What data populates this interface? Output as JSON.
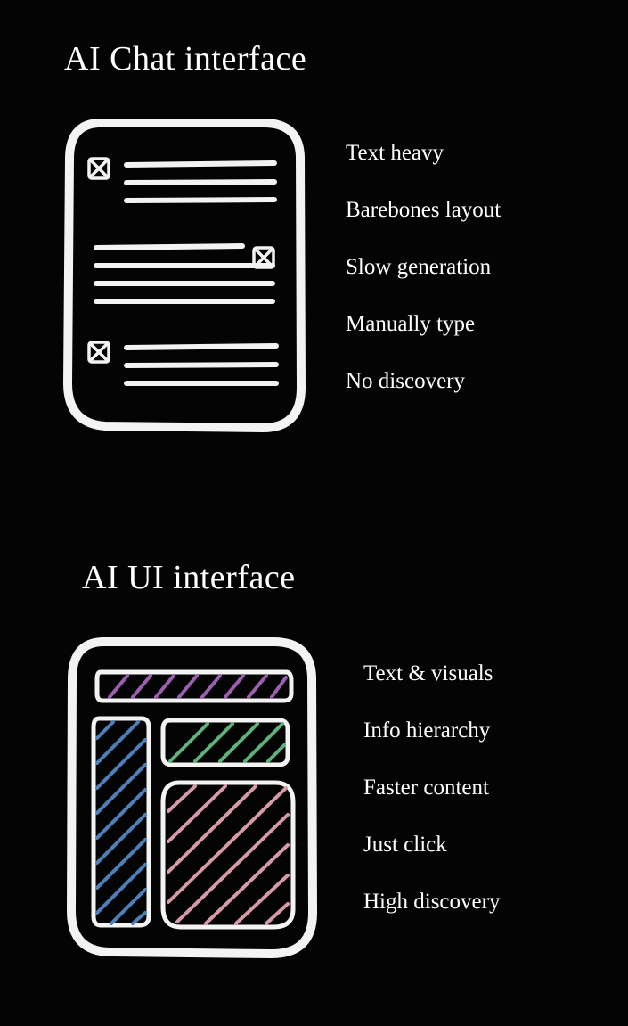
{
  "sections": {
    "chat": {
      "title": "AI Chat interface",
      "bullets": [
        "Text heavy",
        "Barebones layout",
        "Slow generation",
        "Manually type",
        "No discovery"
      ]
    },
    "ui": {
      "title": "AI UI interface",
      "bullets": [
        "Text & visuals",
        "Info hierarchy",
        "Faster content",
        "Just click",
        "High discovery"
      ]
    }
  },
  "colors": {
    "background": "#050404",
    "stroke": "#f3f3f3",
    "purple": "#9a5fb0",
    "blue": "#4d7fb8",
    "green": "#5fb27b",
    "pink": "#d59aa6"
  }
}
